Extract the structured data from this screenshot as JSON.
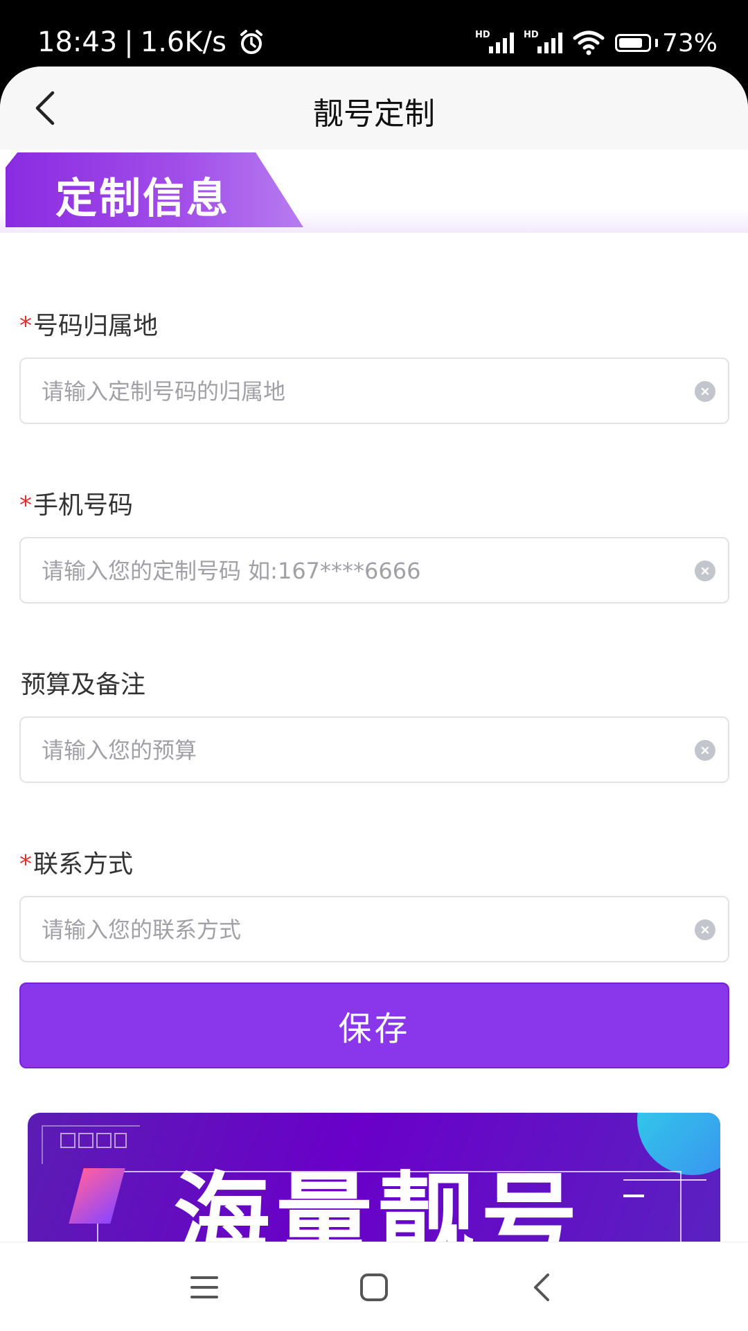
{
  "status": {
    "time": "18:43",
    "network_speed": "1.6K/s",
    "battery": "73%",
    "signal_hd_1": "HD",
    "signal_hd_2": "HD"
  },
  "nav": {
    "title": "靓号定制"
  },
  "section": {
    "title": "定制信息"
  },
  "form": {
    "fields": [
      {
        "label": "号码归属地",
        "required": "*",
        "placeholder": "请输入定制号码的归属地"
      },
      {
        "label": "手机号码",
        "required": "*",
        "placeholder": "请输入您的定制号码 如:167****6666"
      },
      {
        "label": "预算及备注",
        "required": "",
        "placeholder": "请输入您的预算"
      },
      {
        "label": "联系方式",
        "required": "*",
        "placeholder": "请输入您的联系方式"
      }
    ],
    "save_label": "保存"
  },
  "promo": {
    "title": "海量靓号"
  },
  "colors": {
    "accent": "#8a36ea",
    "required": "#e03131"
  },
  "icons": {
    "back": "chevron-left-icon",
    "clear": "clear-circle-icon",
    "menu": "menu-icon",
    "home": "home-square-icon",
    "sys_back": "sys-back-icon"
  }
}
